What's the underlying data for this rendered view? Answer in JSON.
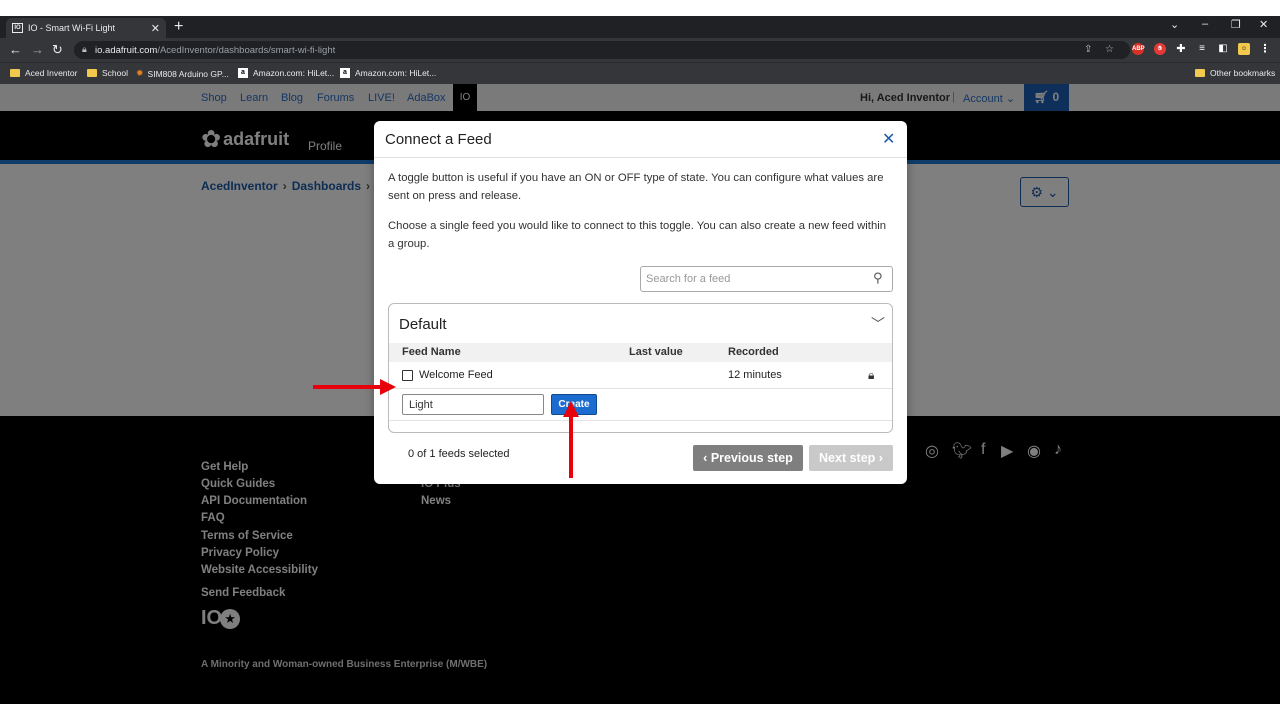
{
  "browser": {
    "tab_title": "IO - Smart Wi-Fi Light",
    "tab_favicon": "IO",
    "new_tab": "+",
    "url_domain": "io.adafruit.com",
    "url_path": "/AcedInventor/dashboards/smart-wi-fi-light",
    "bookmarks": [
      "Aced Inventor",
      "School",
      "SIM808 Arduino GP...",
      "Amazon.com: HiLet...",
      "Amazon.com: HiLet..."
    ],
    "other_bookmarks": "Other bookmarks",
    "extensions": {
      "abp": "ABP"
    }
  },
  "topnav": {
    "links": [
      "Shop",
      "Learn",
      "Blog",
      "Forums",
      "LIVE!",
      "AdaBox"
    ],
    "io": "IO",
    "greeting": "Hi, Aced Inventor",
    "separator": "|",
    "account": "Account",
    "cart_count": "0"
  },
  "header": {
    "logo": "adafruit",
    "profile": "Profile"
  },
  "breadcrumb": [
    "AcedInventor",
    "Dashboards"
  ],
  "footer": {
    "col1": [
      "Get Help",
      "Quick Guides",
      "API Documentation",
      "FAQ",
      "Terms of Service",
      "Privacy Policy",
      "Website Accessibility"
    ],
    "send_feedback": "Send Feedback",
    "col2": [
      "IO Plus",
      "News"
    ],
    "logo": "IO",
    "wbe": "A Minority and Woman-owned Business Enterprise (M/WBE)"
  },
  "modal": {
    "title": "Connect a Feed",
    "desc1": "A toggle button is useful if you have an ON or OFF type of state. You can configure what values are sent on press and release.",
    "desc2": "Choose a single feed you would like to connect to this toggle. You can also create a new feed within a group.",
    "search_placeholder": "Search for a feed",
    "group": {
      "name": "Default",
      "columns": [
        "Feed Name",
        "Last value",
        "Recorded"
      ],
      "rows": [
        {
          "name": "Welcome Feed",
          "last_value": "",
          "recorded": "12 minutes"
        }
      ],
      "new_feed_value": "Light",
      "create_label": "Create"
    },
    "selected_text": "0 of 1 feeds selected",
    "prev_label": "Previous step",
    "next_label": "Next step"
  },
  "colors": {
    "accent": "#1c6cd0",
    "annotation_arrow": "#e8000b"
  }
}
